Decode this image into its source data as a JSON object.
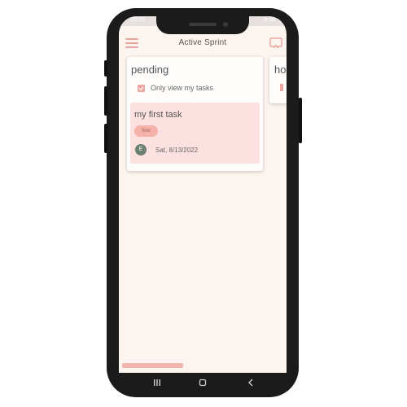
{
  "status_bar": {
    "time": "10:35",
    "right": "5:16"
  },
  "appbar": {
    "title": "Active Sprint",
    "menu_icon": "hamburger-menu-icon",
    "cast_icon": "cast-icon"
  },
  "column": {
    "title": "pending",
    "filter_label": "Only view my tasks",
    "filter_checked": true
  },
  "task": {
    "title": "my first task",
    "priority": "low",
    "assignee_initial": "E",
    "date": "Sat, 8/13/2022"
  },
  "next_column": {
    "title": "ho"
  },
  "nav": {
    "recent_icon": "recents-icon",
    "home_icon": "home-icon",
    "back_icon": "back-icon"
  },
  "colors": {
    "accent": "#eea7a1",
    "task_background": "#fde1e1",
    "screen_background": "#fcf4ef",
    "avatar": "#6c7f73"
  }
}
